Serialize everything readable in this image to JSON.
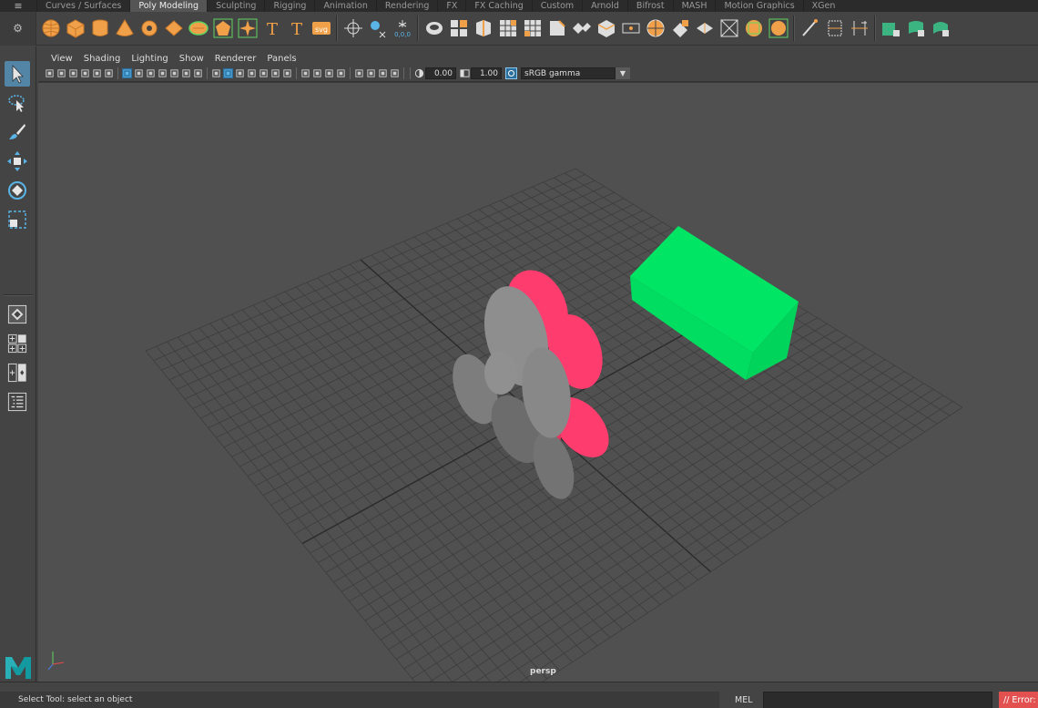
{
  "shelf": {
    "menu_glyph": "≡",
    "gear_glyph": "⚙",
    "tabs": [
      {
        "label": "Curves / Surfaces",
        "active": false
      },
      {
        "label": "Poly Modeling",
        "active": true
      },
      {
        "label": "Sculpting",
        "active": false
      },
      {
        "label": "Rigging",
        "active": false
      },
      {
        "label": "Animation",
        "active": false
      },
      {
        "label": "Rendering",
        "active": false
      },
      {
        "label": "FX",
        "active": false
      },
      {
        "label": "FX Caching",
        "active": false
      },
      {
        "label": "Custom",
        "active": false
      },
      {
        "label": "Arnold",
        "active": false
      },
      {
        "label": "Bifrost",
        "active": false
      },
      {
        "label": "MASH",
        "active": false
      },
      {
        "label": "Motion Graphics",
        "active": false
      },
      {
        "label": "XGen",
        "active": false
      }
    ],
    "icon_buttons": [
      "poly-sphere-icon",
      "poly-cube-icon",
      "poly-cylinder-icon",
      "poly-cone-icon",
      "poly-torus-icon",
      "poly-plane-icon",
      "poly-disc-icon",
      "platonic-solid-icon",
      "super-shape-icon",
      "sweep-mesh-icon",
      "type-tool-icon",
      "svg-tool-icon",
      "sep",
      "center-pivot-icon",
      "freeze-transform-icon",
      "reset-transform-icon",
      "sep",
      "combine-icon",
      "separate-icon",
      "extract-icon",
      "boolean-union-icon",
      "boolean-difference-icon",
      "bevel-icon",
      "bridge-icon",
      "extrude-icon",
      "append-to-polygon-icon",
      "fill-hole-icon",
      "multi-cut-icon",
      "target-weld-icon",
      "connect-icon",
      "quadrangulate-icon",
      "smooth-icon",
      "sep",
      "bevel-tool-icon",
      "edge-loop-icon",
      "insert-loop-icon",
      "sep",
      "uv-planar-icon",
      "uv-cylindrical-icon",
      "uv-spherical-icon"
    ],
    "text_icons": {
      "type": "T",
      "svg": "svg",
      "reset_readout": "0,0,0"
    }
  },
  "toolbox": {
    "tools": [
      {
        "name": "select-tool",
        "active": true
      },
      {
        "name": "lasso-tool",
        "active": false
      },
      {
        "name": "paint-select-tool",
        "active": false
      },
      {
        "name": "move-tool",
        "active": false
      },
      {
        "name": "rotate-tool",
        "active": false
      },
      {
        "name": "scale-tool",
        "active": false
      }
    ],
    "layouts": [
      "single-perspective-layout",
      "four-view-layout",
      "two-view-layout",
      "outliner-layout"
    ]
  },
  "viewport": {
    "menu": [
      "View",
      "Shading",
      "Lighting",
      "Show",
      "Renderer",
      "Panels"
    ],
    "exposure": "0.00",
    "gamma": "1.00",
    "color_space": "sRGB gamma",
    "dropdown_glyph": "▼",
    "camera_label": "persp",
    "colors": {
      "background": "#505050",
      "grid": "#3d3d3d",
      "grid_axis": "#2a2a2a",
      "cube": "#00e564",
      "cube_dark": "#00cc55",
      "petal_red": "#ff3c6e",
      "petal_gray": "#8c8c8c"
    }
  },
  "status": {
    "help_line": "Select Tool: select an object",
    "mel_label": "MEL",
    "command_value": "",
    "error_text": "// Error:"
  },
  "brand": {
    "logo_letter": "M"
  }
}
